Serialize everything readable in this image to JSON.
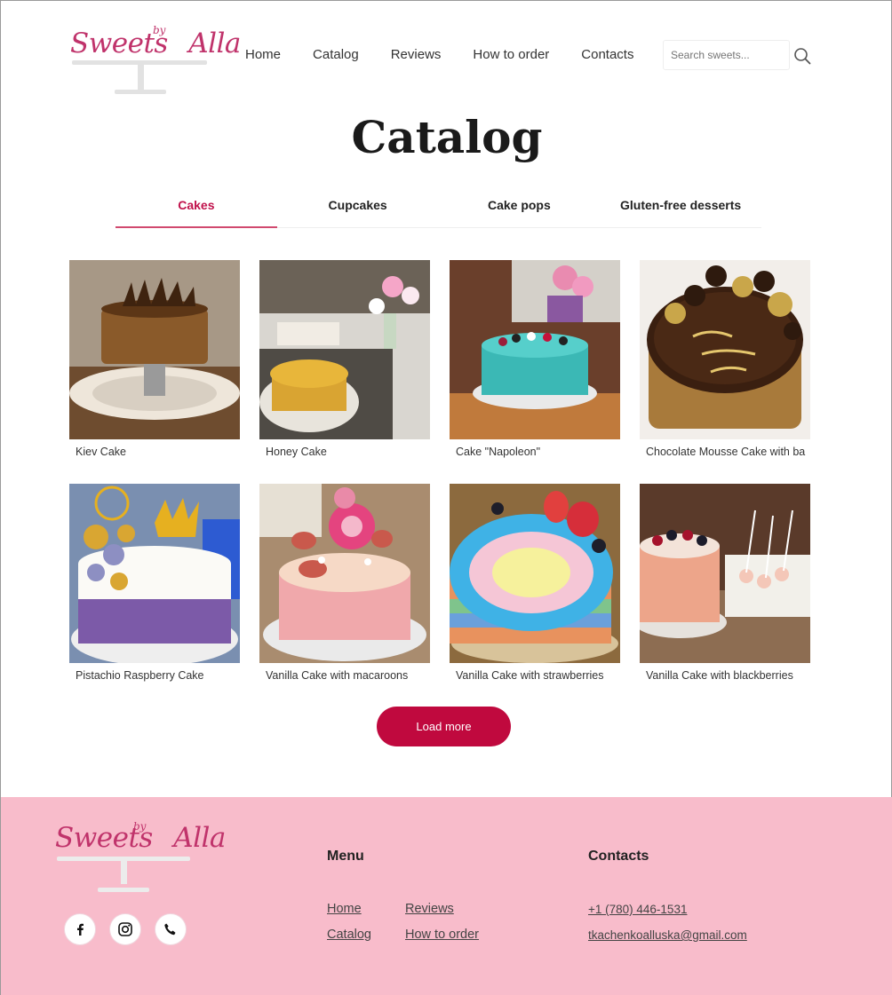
{
  "brand": {
    "logo_main": "Sweets",
    "logo_by": "by",
    "logo_name": "Alla"
  },
  "nav": [
    {
      "label": "Home"
    },
    {
      "label": "Catalog"
    },
    {
      "label": "Reviews"
    },
    {
      "label": "How to order"
    },
    {
      "label": "Contacts"
    }
  ],
  "search": {
    "placeholder": "Search sweets...",
    "icon": "search-icon"
  },
  "page": {
    "title": "Catalog"
  },
  "tabs": [
    {
      "label": "Cakes",
      "active": true
    },
    {
      "label": "Cupcakes",
      "active": false
    },
    {
      "label": "Cake pops",
      "active": false
    },
    {
      "label": "Gluten-free desserts",
      "active": false
    }
  ],
  "products": [
    {
      "name": "Kiev Cake"
    },
    {
      "name": "Honey Cake"
    },
    {
      "name": "Cake \"Napoleon\""
    },
    {
      "name": "Chocolate Mousse Cake with ba"
    },
    {
      "name": "Pistachio Raspberry Cake"
    },
    {
      "name": "Vanilla Cake with macaroons"
    },
    {
      "name": "Vanilla Cake with strawberries"
    },
    {
      "name": "Vanilla Cake with blackberries"
    }
  ],
  "load_more": {
    "label": "Load more"
  },
  "footer": {
    "menu_heading": "Menu",
    "menu_links": [
      {
        "label": "Home"
      },
      {
        "label": "Reviews"
      },
      {
        "label": "Catalog"
      },
      {
        "label": "How to order"
      }
    ],
    "contacts_heading": "Contacts",
    "phone": "+1 (780) 446-1531",
    "email": "tkachenkoalluska@gmail.com",
    "social_icons": [
      "facebook-icon",
      "instagram-icon",
      "phone-icon"
    ]
  },
  "colors": {
    "accent": "#c0093e",
    "footer_bg": "#f8bccb",
    "logo": "#c0336b"
  }
}
